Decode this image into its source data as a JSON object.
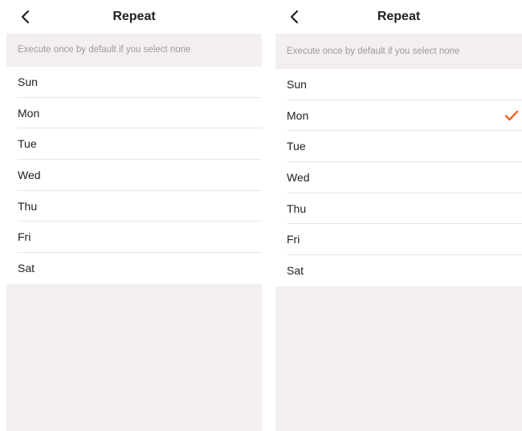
{
  "left_screen": {
    "title": "Repeat",
    "hint": "Execute once by default if you select none",
    "days": [
      {
        "label": "Sun",
        "selected": false
      },
      {
        "label": "Mon",
        "selected": false
      },
      {
        "label": "Tue",
        "selected": false
      },
      {
        "label": "Wed",
        "selected": false
      },
      {
        "label": "Thu",
        "selected": false
      },
      {
        "label": "Fri",
        "selected": false
      },
      {
        "label": "Sat",
        "selected": false
      }
    ]
  },
  "right_screen": {
    "title": "Repeat",
    "hint": "Execute once by default if you select none",
    "days": [
      {
        "label": "Sun",
        "selected": false
      },
      {
        "label": "Mon",
        "selected": true
      },
      {
        "label": "Tue",
        "selected": false
      },
      {
        "label": "Wed",
        "selected": false
      },
      {
        "label": "Thu",
        "selected": false
      },
      {
        "label": "Fri",
        "selected": false
      },
      {
        "label": "Sat",
        "selected": false
      }
    ]
  },
  "icons": {
    "back": "chevron-left-icon",
    "check": "checkmark-icon"
  },
  "colors": {
    "accent": "#ef6a2f",
    "background": "#f3efef"
  }
}
